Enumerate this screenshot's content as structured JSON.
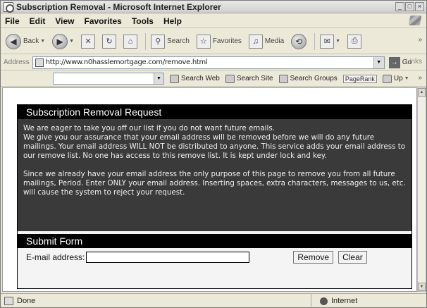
{
  "window": {
    "title": "Subscription Removal - Microsoft Internet Explorer"
  },
  "menu": [
    "File",
    "Edit",
    "View",
    "Favorites",
    "Tools",
    "Help"
  ],
  "toolbar": {
    "back_label": "Back",
    "search_label": "Search",
    "favorites_label": "Favorites",
    "media_label": "Media",
    "more": "»"
  },
  "address": {
    "label": "Address",
    "url": "http://www.n0hasslemortgage.com/remove.html",
    "go_label": "Go",
    "links_label": "Links"
  },
  "google_toolbar": {
    "search_web": "Search Web",
    "search_site": "Search Site",
    "search_groups": "Search Groups",
    "pagerank": "PageRank",
    "up": "Up",
    "more": "»"
  },
  "page": {
    "heading": "Subscription Removal Request",
    "paragraph1": "We are eager to take you off our list if you do not want future emails.\nWe give you our assurance that your email address will be removed before we will do any future mailings. Your email address WILL NOT be distributed to anyone. This service adds your email address to our remove list. No one has access to this remove list. It is kept under lock and key.",
    "paragraph2": "Since we already have your email address the only purpose of this page to remove you from all future mailings, Period. Enter ONLY your email address. Inserting spaces, extra characters, messages to us, etc. will cause the system to reject your request.",
    "form_heading": "Submit Form",
    "email_label": "E-mail address:",
    "email_value": "",
    "remove_label": "Remove",
    "clear_label": "Clear"
  },
  "status": {
    "text": "Done",
    "zone": "Internet"
  }
}
